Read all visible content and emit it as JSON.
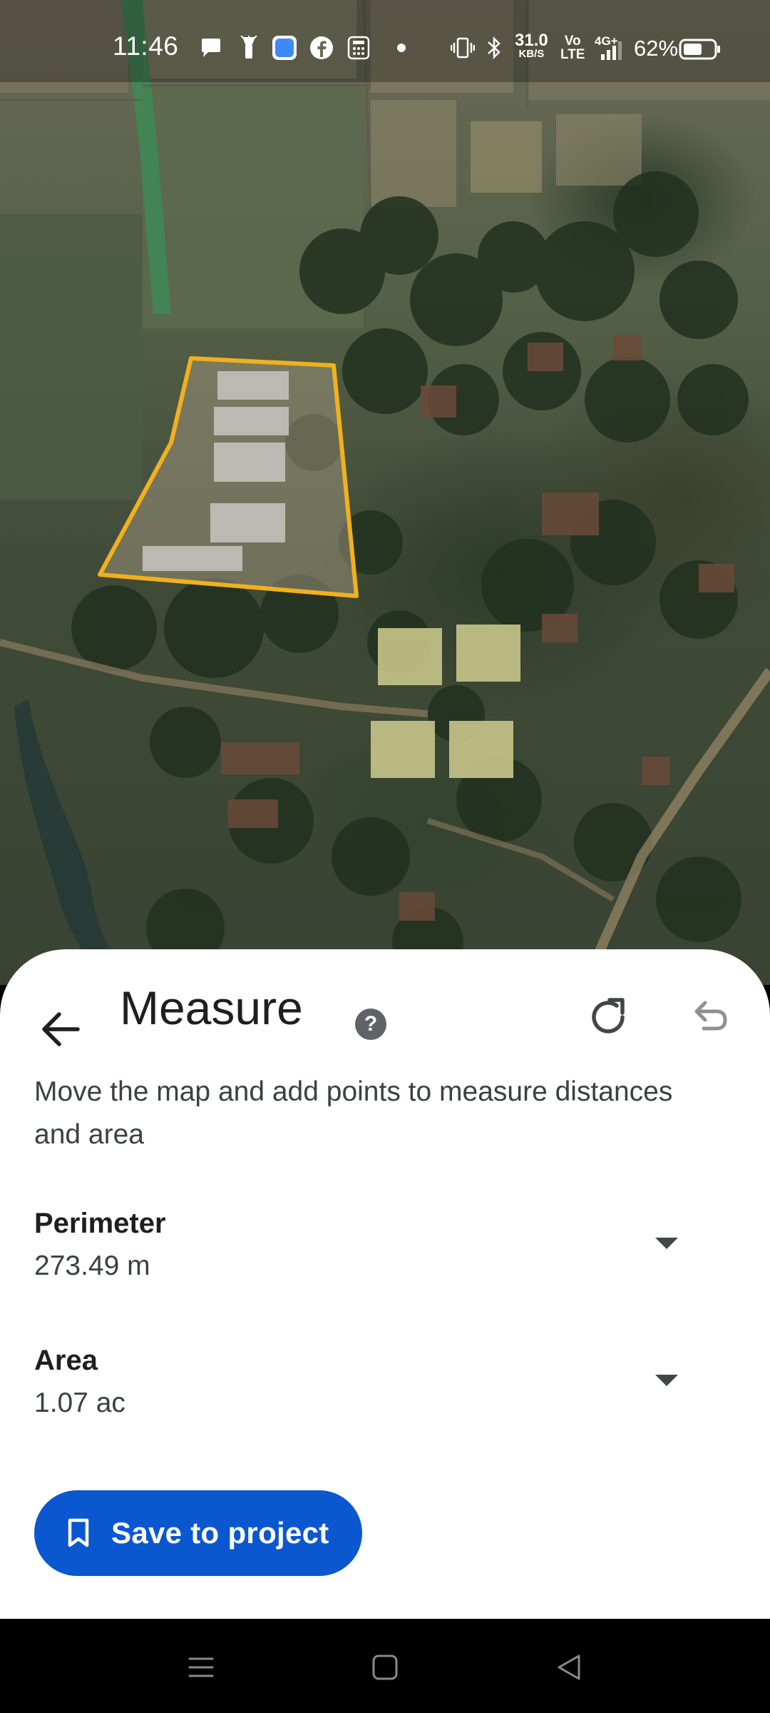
{
  "status_bar": {
    "time": "11:46",
    "net_speed_value": "31.0",
    "net_speed_unit": "KB/S",
    "volte_line1": "Vo",
    "volte_line2": "LTE",
    "network_type": "4G+",
    "battery_percent": "62%",
    "battery_level": 0.62,
    "notification_icons": [
      "chat-bubble-icon",
      "flashlight-app-icon",
      "blue-app-icon",
      "facebook-icon",
      "calculator-icon",
      "dot-icon"
    ],
    "system_icons": [
      "vibrate-icon",
      "bluetooth-icon",
      "signal-icon",
      "battery-icon"
    ]
  },
  "map": {
    "polygon_stroke_color": "#f2b01e"
  },
  "sheet": {
    "title": "Measure",
    "help_icon_text": "?",
    "instructions": "Move the map and add points to measure distances and area",
    "perimeter": {
      "label": "Perimeter",
      "value": "273.49 m"
    },
    "area": {
      "label": "Area",
      "value": "1.07 ac"
    },
    "save_label": "Save to project"
  },
  "colors": {
    "accent": "#0b57d0",
    "text_primary": "#1f1f1f",
    "text_secondary": "#3c4043",
    "icon_gray": "#5f6368",
    "sheet_bg": "#ffffff"
  },
  "nav_bar": {
    "buttons": [
      "menu-icon",
      "home-icon",
      "back-triangle-icon"
    ]
  }
}
